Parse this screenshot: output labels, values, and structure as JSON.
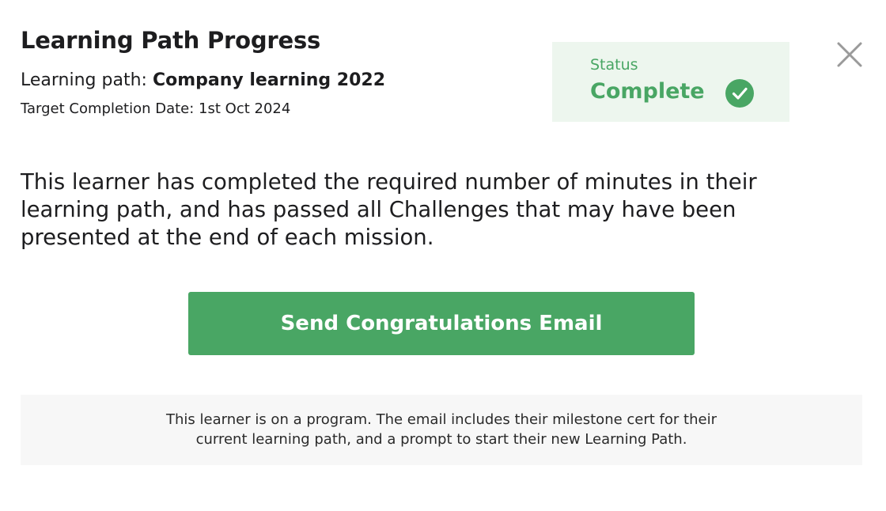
{
  "header": {
    "title": "Learning Path Progress",
    "path_prefix": "Learning path: ",
    "path_name": "Company learning 2022",
    "target_completion": "Target Completion Date: 1st Oct 2024"
  },
  "status": {
    "label": "Status",
    "value": "Complete",
    "icon": "check-circle-icon",
    "color": "#49a664",
    "background": "#edf6ee"
  },
  "close": {
    "icon": "close-icon",
    "color": "#9a9a9a"
  },
  "description": "This learner has completed the required number of minutes in their learning path, and has passed all Challenges that may have been presented at the end of each mission.",
  "actions": {
    "send_email_label": "Send Congratulations Email",
    "button_color": "#49a664"
  },
  "note": {
    "line1": "This learner is on a program. The email includes their milestone cert for their",
    "line2": "current learning path, and a prompt to start their new Learning Path."
  }
}
